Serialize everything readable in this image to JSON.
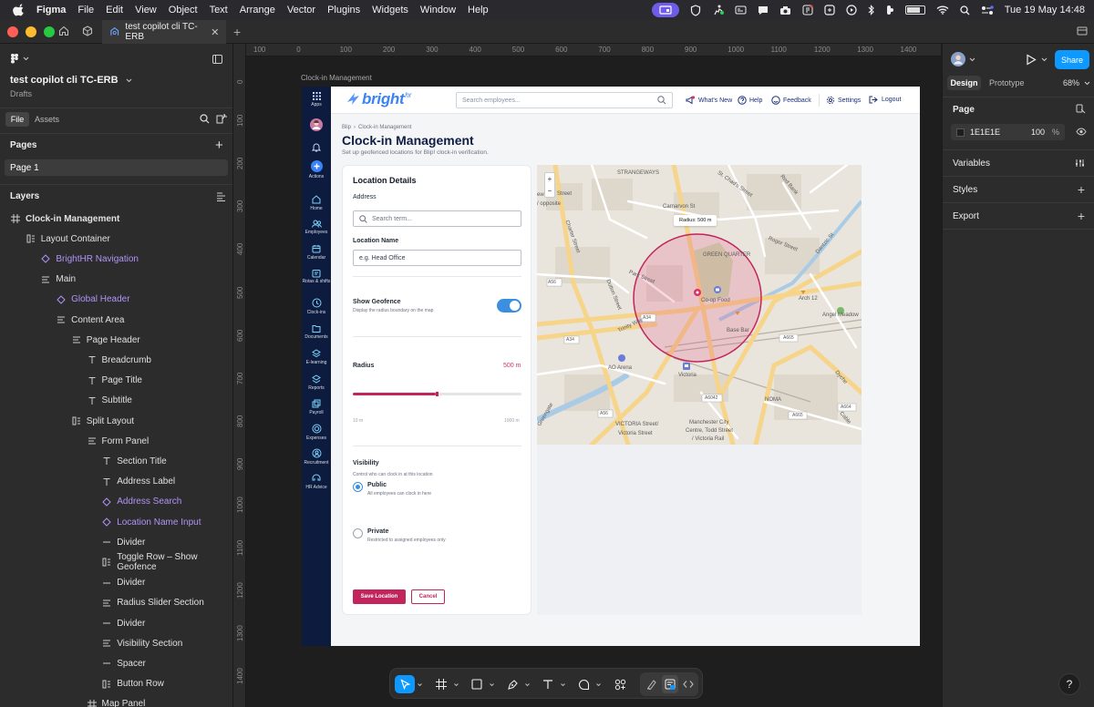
{
  "menubar": {
    "app": "Figma",
    "items": [
      "File",
      "Edit",
      "View",
      "Object",
      "Text",
      "Arrange",
      "Vector",
      "Plugins",
      "Widgets",
      "Window",
      "Help"
    ],
    "datetime": "Tue 19 May  14:48"
  },
  "tabbar": {
    "tab_title": "test copilot cli TC-ERB"
  },
  "file": {
    "name": "test copilot cli TC-ERB",
    "location": "Drafts",
    "tab_file": "File",
    "tab_assets": "Assets"
  },
  "pages": {
    "title": "Pages",
    "items": [
      "Page 1"
    ]
  },
  "layers": {
    "title": "Layers",
    "items": [
      {
        "label": "Clock-in Management",
        "indent": 0,
        "icon": "frame",
        "purple": false,
        "bold": true
      },
      {
        "label": "Layout Container",
        "indent": 1,
        "icon": "autolayout",
        "purple": false
      },
      {
        "label": "BrightHR Navigation",
        "indent": 2,
        "icon": "instance",
        "purple": true
      },
      {
        "label": "Main",
        "indent": 2,
        "icon": "stack",
        "purple": false
      },
      {
        "label": "Global Header",
        "indent": 3,
        "icon": "instance",
        "purple": true
      },
      {
        "label": "Content Area",
        "indent": 3,
        "icon": "stack",
        "purple": false
      },
      {
        "label": "Page Header",
        "indent": 4,
        "icon": "stack",
        "purple": false
      },
      {
        "label": "Breadcrumb",
        "indent": 5,
        "icon": "text",
        "purple": false
      },
      {
        "label": "Page Title",
        "indent": 5,
        "icon": "text",
        "purple": false
      },
      {
        "label": "Subtitle",
        "indent": 5,
        "icon": "text",
        "purple": false
      },
      {
        "label": "Split Layout",
        "indent": 4,
        "icon": "autolayout",
        "purple": false
      },
      {
        "label": "Form Panel",
        "indent": 5,
        "icon": "stack",
        "purple": false
      },
      {
        "label": "Section Title",
        "indent": 6,
        "icon": "text",
        "purple": false
      },
      {
        "label": "Address Label",
        "indent": 6,
        "icon": "text",
        "purple": false
      },
      {
        "label": "Address Search",
        "indent": 6,
        "icon": "instance",
        "purple": true
      },
      {
        "label": "Location Name Input",
        "indent": 6,
        "icon": "instance",
        "purple": true
      },
      {
        "label": "Divider",
        "indent": 6,
        "icon": "line",
        "purple": false
      },
      {
        "label": "Toggle Row – Show Geofence",
        "indent": 6,
        "icon": "autolayout",
        "purple": false
      },
      {
        "label": "Divider",
        "indent": 6,
        "icon": "line",
        "purple": false
      },
      {
        "label": "Radius Slider Section",
        "indent": 6,
        "icon": "stack",
        "purple": false
      },
      {
        "label": "Divider",
        "indent": 6,
        "icon": "line",
        "purple": false
      },
      {
        "label": "Visibility Section",
        "indent": 6,
        "icon": "stack",
        "purple": false
      },
      {
        "label": "Spacer",
        "indent": 6,
        "icon": "line",
        "purple": false
      },
      {
        "label": "Button Row",
        "indent": 6,
        "icon": "autolayout",
        "purple": false
      },
      {
        "label": "Map Panel",
        "indent": 5,
        "icon": "hash",
        "purple": false
      }
    ]
  },
  "ruler_top": [
    "100",
    "0",
    "100",
    "200",
    "300",
    "400",
    "500",
    "600",
    "700",
    "800",
    "900",
    "1000",
    "1100",
    "1200",
    "1300",
    "1400"
  ],
  "ruler_left": [
    "0",
    "100",
    "200",
    "300",
    "400",
    "500",
    "600",
    "700",
    "800",
    "900",
    "1000",
    "1100",
    "1200",
    "1300",
    "1400"
  ],
  "frame_label": "Clock-in Management",
  "right": {
    "share": "Share",
    "tab_design": "Design",
    "tab_prototype": "Prototype",
    "zoom": "68%",
    "page_title": "Page",
    "page_color": "1E1E1E",
    "page_opacity": "100",
    "percent": "%",
    "variables": "Variables",
    "styles": "Styles",
    "export": "Export",
    "colors": {
      "accent": "#0d99ff"
    }
  },
  "nav": [
    {
      "label": "Apps",
      "icon": "grid-icon"
    },
    {
      "label": "",
      "icon": "avatar"
    },
    {
      "label": "",
      "icon": "bell-icon"
    },
    {
      "label": "Actions",
      "icon": "plus-circle-icon"
    },
    {
      "label": "Home",
      "icon": "home-icon"
    },
    {
      "label": "Employees",
      "icon": "people-icon"
    },
    {
      "label": "Calendar",
      "icon": "calendar-icon"
    },
    {
      "label": "Rotas & shifts",
      "icon": "rota-icon"
    },
    {
      "label": "Clock-ins",
      "icon": "clock-icon"
    },
    {
      "label": "Documents",
      "icon": "folder-icon"
    },
    {
      "label": "E-learning",
      "icon": "learning-icon"
    },
    {
      "label": "Reports",
      "icon": "reports-icon"
    },
    {
      "label": "Payroll",
      "icon": "payroll-icon"
    },
    {
      "label": "Expenses",
      "icon": "expenses-icon"
    },
    {
      "label": "Recruitment",
      "icon": "recruit-icon"
    },
    {
      "label": "HR Advice",
      "icon": "advice-icon"
    }
  ],
  "header": {
    "logo": "bright",
    "logo_sup": "hr",
    "search_placeholder": "Search employees...",
    "whats_new": "What's New",
    "help": "Help",
    "feedback": "Feedback",
    "settings": "Settings",
    "logout": "Logout"
  },
  "page": {
    "breadcrumb_root": "Blip",
    "breadcrumb_sep": "›",
    "breadcrumb_current": "Clock-in Management",
    "title": "Clock-in Management",
    "subtitle": "Set up geofenced locations for Blip! clock-in verification."
  },
  "form": {
    "section_title": "Location Details",
    "address_label": "Address",
    "address_placeholder": "Search term...",
    "name_label": "Location Name",
    "name_value": "e.g. Head Office",
    "geofence_title": "Show Geofence",
    "geofence_sub": "Display the radius boundary on the map",
    "geofence_on": true,
    "radius_label": "Radius",
    "radius_value": "500 m",
    "radius_fraction": 0.5,
    "radius_min": "10 m",
    "radius_max": "1000 m",
    "visibility_title": "Visibility",
    "visibility_sub": "Control who can clock in at this location",
    "public_title": "Public",
    "public_sub": "All employees can clock in here",
    "private_title": "Private",
    "private_sub": "Restricted to assigned employees only",
    "save": "Save Location",
    "cancel": "Cancel",
    "colors": {
      "brand": "#d6336c",
      "navy": "#1b2f7a"
    }
  },
  "map": {
    "zoom_in": "+",
    "zoom_out": "−",
    "radius_badge": "Radius: 500 m",
    "places": [
      {
        "text": "STRANGEWAYS"
      },
      {
        "text": "St. Chad's Street"
      },
      {
        "text": "Red Bank"
      },
      {
        "text": "Carnarvon St"
      },
      {
        "text": "Roger Street"
      },
      {
        "text": "GREEN QUARTER"
      },
      {
        "text": "Charter Street"
      },
      {
        "text": "Dantzic St"
      },
      {
        "text": "Park Street"
      },
      {
        "text": "Dutton Street"
      },
      {
        "text": "Co-op Food"
      },
      {
        "text": "A56"
      },
      {
        "text": "Arch 12"
      },
      {
        "text": "Angel Meadow"
      },
      {
        "text": "A34"
      },
      {
        "text": "Trinity Way"
      },
      {
        "text": "Base Bar"
      },
      {
        "text": "A665"
      },
      {
        "text": "A34"
      },
      {
        "text": "AO Arena"
      },
      {
        "text": "Victoria"
      },
      {
        "text": "A6042"
      },
      {
        "text": "NOMA"
      },
      {
        "text": "A664"
      },
      {
        "text": "A56"
      },
      {
        "text": "A665"
      },
      {
        "text": "VICTORIA Street/"
      },
      {
        "text": "Victoria Street"
      },
      {
        "text": "Manchester City"
      },
      {
        "text": "Centre, Todd Street"
      },
      {
        "text": "/ Victoria Rail"
      },
      {
        "text": "Dyche"
      },
      {
        "text": "Cable"
      },
      {
        "text": "ew"
      },
      {
        "text": "Street"
      },
      {
        "text": "/ opposite"
      },
      {
        "text": "Greengate"
      }
    ]
  },
  "toolbar": {
    "items": [
      "move-icon",
      "frame-icon",
      "shape-icon",
      "pen-icon",
      "text-icon",
      "comment-icon",
      "actions-icon",
      "draw-icon",
      "dev-mode-icon",
      "code-icon"
    ]
  }
}
